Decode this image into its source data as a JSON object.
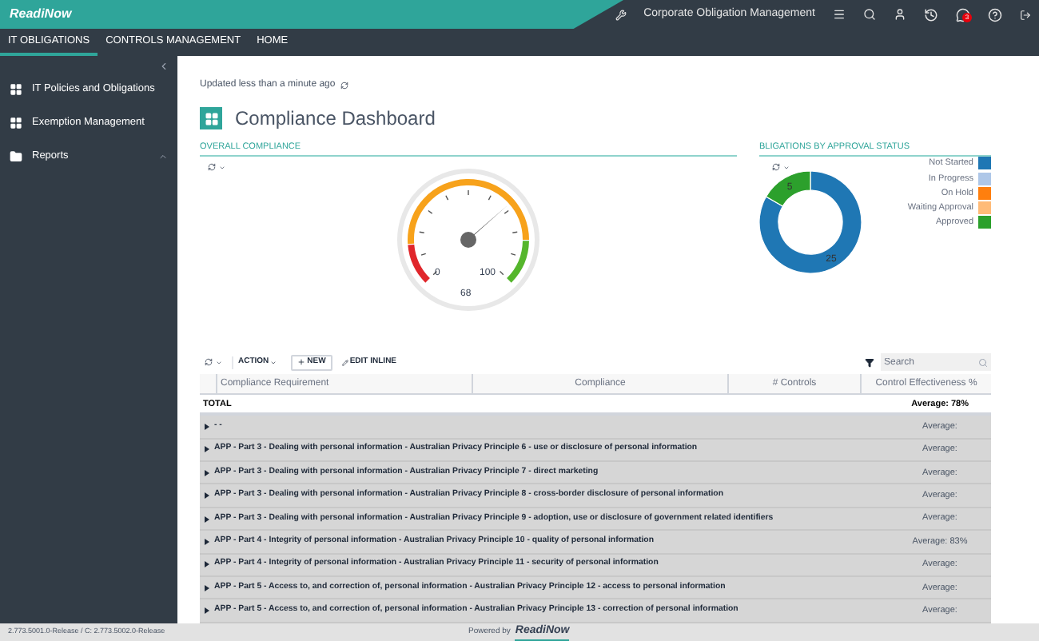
{
  "header": {
    "logo": "ReadiNow",
    "app_title": "Corporate Obligation Management",
    "notification_count": "3"
  },
  "tabs": [
    {
      "label": "IT OBLIGATIONS",
      "selected": true
    },
    {
      "label": "CONTROLS MANAGEMENT",
      "selected": false
    },
    {
      "label": "HOME",
      "selected": false
    }
  ],
  "sidebar": {
    "items": [
      {
        "label": "IT Policies and Obligations",
        "kind": "grid"
      },
      {
        "label": "Exemption Management",
        "kind": "grid"
      },
      {
        "label": "Reports",
        "kind": "folder",
        "expanded": true
      }
    ]
  },
  "updated": "Updated less than a minute ago",
  "page_title": "Compliance Dashboard",
  "overall": {
    "title": "OVERALL COMPLIANCE",
    "gauge": {
      "level": 0.68,
      "min_label": "0",
      "max_label": "100",
      "value_label": "68"
    }
  },
  "approval": {
    "title": "BLIGATIONS BY APPROVAL STATUS",
    "chart_data": {
      "type": "donut",
      "categories": [
        "Not Started",
        "In Progress",
        "On Hold",
        "Waiting Approval",
        "Approved"
      ],
      "values": [
        25,
        0,
        0,
        0,
        5
      ],
      "colors": [
        "#1f77b4",
        "#aec7e8",
        "#ff7f0e",
        "#ffbb78",
        "#2ca02c"
      ],
      "data_labels": true
    }
  },
  "toolbar": {
    "action": "ACTION",
    "new": "NEW",
    "edit_inline": "EDIT INLINE",
    "search_placeholder": "Search"
  },
  "table": {
    "columns": [
      "Compliance Requirement",
      "Compliance",
      "# Controls",
      "Control Effectiveness %"
    ],
    "total": {
      "label": "TOTAL",
      "value": "Average: 78%"
    },
    "rows": [
      {
        "label": "- -",
        "value": "Average:"
      },
      {
        "label": "APP - Part 3 - Dealing with personal information - Australian Privacy Principle 6 - use or disclosure of personal information",
        "value": "Average:"
      },
      {
        "label": "APP - Part 3 - Dealing with personal information - Australian Privacy Principle 7 - direct marketing",
        "value": "Average:"
      },
      {
        "label": "APP - Part 3 - Dealing with personal information - Australian Privacy Principle 8 - cross-border disclosure of personal information",
        "value": "Average:"
      },
      {
        "label": "APP - Part 3 - Dealing with personal information - Australian Privacy Principle 9 - adoption, use or disclosure of government related identifiers",
        "value": "Average:"
      },
      {
        "label": "APP - Part 4 - Integrity of personal information - Australian Privacy Principle 10 - quality of personal information",
        "value": "Average: 83%"
      },
      {
        "label": "APP - Part 4 - Integrity of personal information - Australian Privacy Principle 11 - security of personal information",
        "value": "Average:"
      },
      {
        "label": "APP - Part 5 - Access to, and correction of, personal information - Australian Privacy Principle 12 - access to personal information",
        "value": "Average:"
      },
      {
        "label": "APP - Part 5 - Access to, and correction of, personal information - Australian Privacy Principle 13 - correction of personal information",
        "value": "Average:"
      }
    ]
  },
  "footer": {
    "version": "2.773.5001.0-Release / C: 2.773.5002.0-Release",
    "powered_by": "Powered by",
    "brand": "ReadiNow"
  }
}
